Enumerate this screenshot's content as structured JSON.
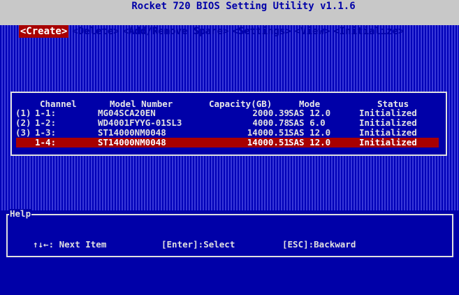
{
  "title": "Rocket 720 BIOS Setting Utility v1.1.6",
  "menu": [
    {
      "label": "<Create>",
      "active": true
    },
    {
      "label": "<Delete>",
      "active": false
    },
    {
      "label": "<Add/Remove Spare>",
      "active": false
    },
    {
      "label": "<Settings>",
      "active": false
    },
    {
      "label": "<View>",
      "active": false
    },
    {
      "label": "<Initialize>",
      "active": false
    }
  ],
  "table": {
    "headers": {
      "channel": "Channel",
      "model": "Model Number",
      "capacity": "Capacity(GB)",
      "mode": "Mode",
      "status": "Status"
    },
    "rows": [
      {
        "index": "(1)",
        "channel": "1-1:",
        "model": "MG04SCA20EN",
        "capacity": "2000.39",
        "mode": "SAS 12.0",
        "status": "Initialized"
      },
      {
        "index": "(2)",
        "channel": "1-2:",
        "model": "WD4001FYYG-01SL3",
        "capacity": "4000.78",
        "mode": "SAS 6.0",
        "status": "Initialized"
      },
      {
        "index": "(3)",
        "channel": "1-3:",
        "model": "ST14000NM0048",
        "capacity": "14000.51",
        "mode": "SAS 12.0",
        "status": "Initialized"
      },
      {
        "index": "",
        "channel": "1-4:",
        "model": "ST14000NM0048",
        "capacity": "14000.51",
        "mode": "SAS 12.0",
        "status": "Initialized"
      }
    ],
    "selected_row": 3
  },
  "help": {
    "title": "Help",
    "items": [
      {
        "text": "↑↓←: Next Item"
      },
      {
        "text": "[Enter]:Select"
      },
      {
        "text": "[ESC]:Backward"
      }
    ]
  },
  "colors": {
    "background": "#0000a8",
    "bar": "#c8c8c8",
    "highlight": "#a80000",
    "text": "#e0e0e0"
  }
}
